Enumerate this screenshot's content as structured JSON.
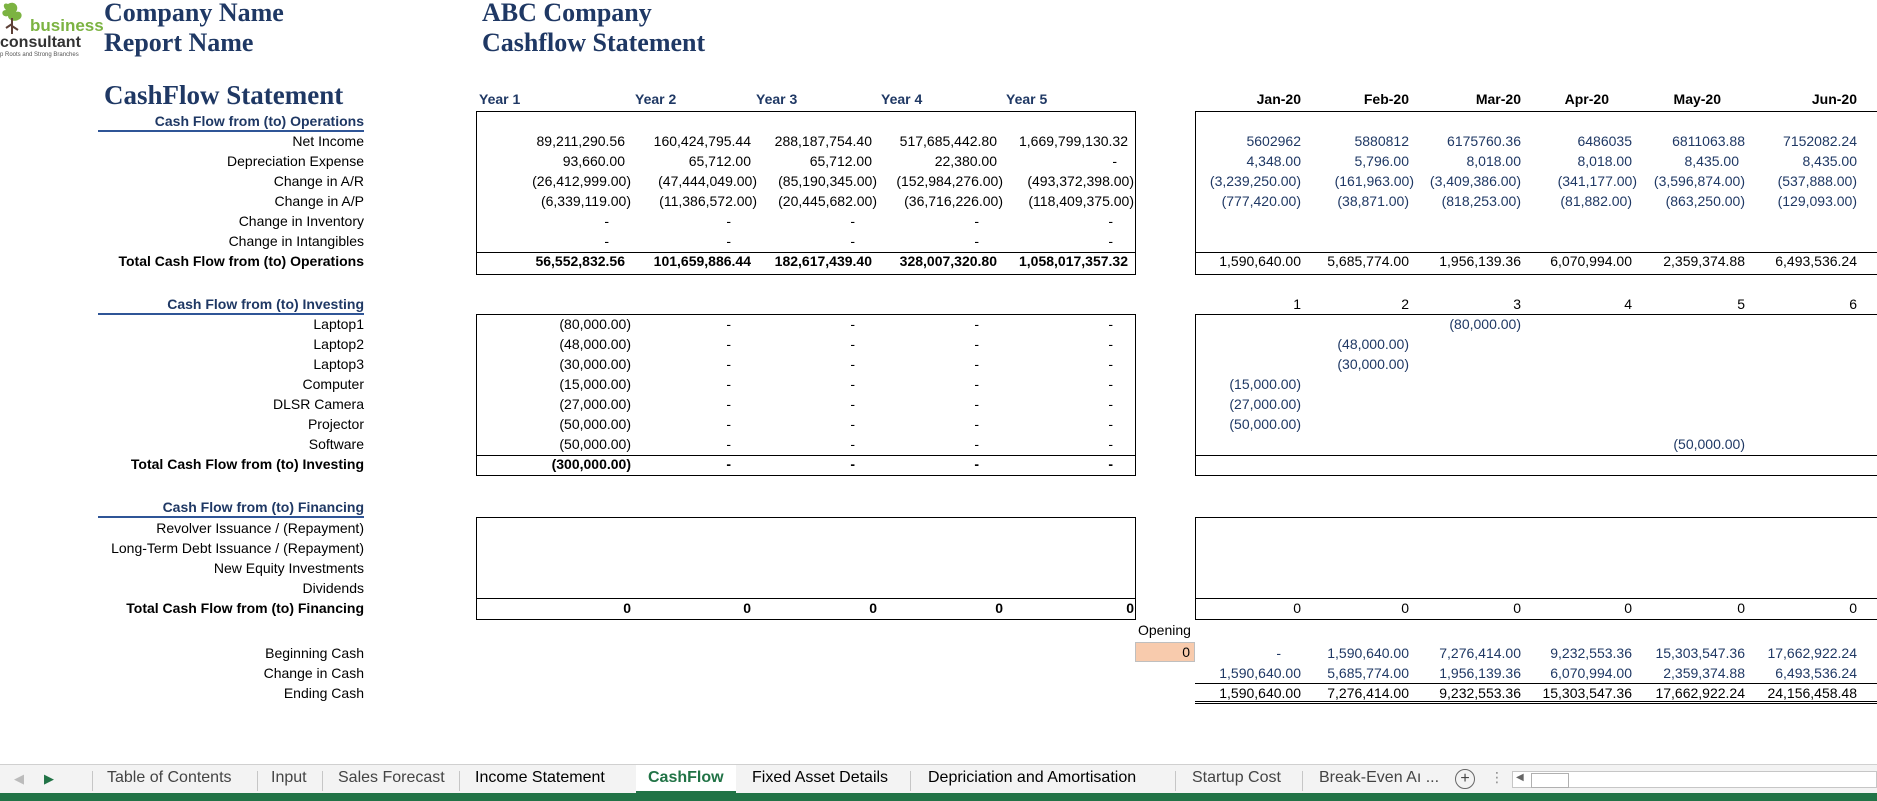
{
  "header": {
    "company_label": "Company Name",
    "report_label": "Report Name",
    "company_value": "ABC Company",
    "report_value": "Cashflow Statement",
    "title": "CashFlow Statement"
  },
  "logo": {
    "word1": "business",
    "word2": "consultant",
    "tagline": "p Roots and Strong Branches",
    "icon": "tree-logo-icon"
  },
  "years": [
    "Year 1",
    "Year 2",
    "Year 3",
    "Year 4",
    "Year 5"
  ],
  "months": [
    "Jan-20",
    "Feb-20",
    "Mar-20",
    "Apr-20",
    "May-20",
    "Jun-20"
  ],
  "month_numbers": [
    "1",
    "2",
    "3",
    "4",
    "5",
    "6"
  ],
  "operations": {
    "title": "Cash Flow from (to) Operations",
    "rows": [
      {
        "label": "Net Income",
        "years": [
          "89,211,290.56",
          "160,424,795.44",
          "288,187,754.40",
          "517,685,442.80",
          "1,669,799,130.32"
        ],
        "months": [
          "5602962",
          "5880812",
          "6175760.36",
          "6486035",
          "6811063.88",
          "7152082.24"
        ]
      },
      {
        "label": "Depreciation Expense",
        "years": [
          "93,660.00",
          "65,712.00",
          "65,712.00",
          "22,380.00",
          "-"
        ],
        "months": [
          "4,348.00",
          "5,796.00",
          "8,018.00",
          "8,018.00",
          "8,435.00",
          "8,435.00"
        ]
      },
      {
        "label": "Change in A/R",
        "years": [
          "(26,412,999.00)",
          "(47,444,049.00)",
          "(85,190,345.00)",
          "(152,984,276.00)",
          "(493,372,398.00)"
        ],
        "months": [
          "(3,239,250.00)",
          "(161,963.00)",
          "(3,409,386.00)",
          "(341,177.00)",
          "(3,596,874.00)",
          "(537,888.00)"
        ]
      },
      {
        "label": "Change in A/P",
        "years": [
          "(6,339,119.00)",
          "(11,386,572.00)",
          "(20,445,682.00)",
          "(36,716,226.00)",
          "(118,409,375.00)"
        ],
        "months": [
          "(777,420.00)",
          "(38,871.00)",
          "(818,253.00)",
          "(81,882.00)",
          "(863,250.00)",
          "(129,093.00)"
        ]
      },
      {
        "label": "Change in Inventory",
        "years": [
          "-",
          "-",
          "-",
          "-",
          "-"
        ],
        "months": [
          "",
          "",
          "",
          "",
          "",
          ""
        ]
      },
      {
        "label": "Change in Intangibles",
        "years": [
          "-",
          "-",
          "-",
          "-",
          "-"
        ],
        "months": [
          "",
          "",
          "",
          "",
          "",
          ""
        ]
      }
    ],
    "total_label": "Total Cash Flow from (to) Operations",
    "total_years": [
      "56,552,832.56",
      "101,659,886.44",
      "182,617,439.40",
      "328,007,320.80",
      "1,058,017,357.32"
    ],
    "total_months": [
      "1,590,640.00",
      "5,685,774.00",
      "1,956,139.36",
      "6,070,994.00",
      "2,359,374.88",
      "6,493,536.24"
    ]
  },
  "investing": {
    "title": "Cash Flow from (to) Investing",
    "rows": [
      {
        "label": "Laptop1",
        "years": [
          "(80,000.00)",
          "-",
          "-",
          "-",
          "-"
        ],
        "months": [
          "",
          "",
          "(80,000.00)",
          "",
          "",
          ""
        ]
      },
      {
        "label": "Laptop2",
        "years": [
          "(48,000.00)",
          "-",
          "-",
          "-",
          "-"
        ],
        "months": [
          "",
          "(48,000.00)",
          "",
          "",
          "",
          ""
        ]
      },
      {
        "label": "Laptop3",
        "years": [
          "(30,000.00)",
          "-",
          "-",
          "-",
          "-"
        ],
        "months": [
          "",
          "(30,000.00)",
          "",
          "",
          "",
          ""
        ]
      },
      {
        "label": "Computer",
        "years": [
          "(15,000.00)",
          "-",
          "-",
          "-",
          "-"
        ],
        "months": [
          "(15,000.00)",
          "",
          "",
          "",
          "",
          ""
        ]
      },
      {
        "label": "DLSR Camera",
        "years": [
          "(27,000.00)",
          "-",
          "-",
          "-",
          "-"
        ],
        "months": [
          "(27,000.00)",
          "",
          "",
          "",
          "",
          ""
        ]
      },
      {
        "label": "Projector",
        "years": [
          "(50,000.00)",
          "-",
          "-",
          "-",
          "-"
        ],
        "months": [
          "(50,000.00)",
          "",
          "",
          "",
          "",
          ""
        ]
      },
      {
        "label": "Software",
        "years": [
          "(50,000.00)",
          "-",
          "-",
          "-",
          "-"
        ],
        "months": [
          "",
          "",
          "",
          "",
          "(50,000.00)",
          ""
        ]
      }
    ],
    "total_label": "Total Cash Flow from (to) Investing",
    "total_years": [
      "(300,000.00)",
      "-",
      "-",
      "-",
      "-"
    ]
  },
  "financing": {
    "title": "Cash Flow from (to) Financing",
    "rows": [
      {
        "label": "Revolver Issuance / (Repayment)"
      },
      {
        "label": "Long-Term Debt Issuance / (Repayment)"
      },
      {
        "label": "New Equity Investments"
      },
      {
        "label": "Dividends"
      }
    ],
    "total_label": "Total Cash Flow from (to) Financing",
    "total_years": [
      "0",
      "0",
      "0",
      "0",
      "0"
    ],
    "total_months": [
      "0",
      "0",
      "0",
      "0",
      "0",
      "0"
    ]
  },
  "cash": {
    "opening_label": "Opening",
    "opening_value": "0",
    "rows": [
      {
        "label": "Beginning Cash",
        "months": [
          "-",
          "1,590,640.00",
          "7,276,414.00",
          "9,232,553.36",
          "15,303,547.36",
          "17,662,922.24"
        ]
      },
      {
        "label": "Change in Cash",
        "months": [
          "1,590,640.00",
          "5,685,774.00",
          "1,956,139.36",
          "6,070,994.00",
          "2,359,374.88",
          "6,493,536.24"
        ]
      },
      {
        "label": "Ending Cash",
        "months": [
          "1,590,640.00",
          "7,276,414.00",
          "9,232,553.36",
          "15,303,547.36",
          "17,662,922.24",
          "24,156,458.48"
        ]
      }
    ]
  },
  "tabs": [
    "Table of Contents",
    "Input",
    "Sales Forecast",
    "Income Statement",
    "CashFlow",
    "Fixed Asset Details",
    "Depriciation and Amortisation",
    "Startup Cost",
    "Break-Even Aı ..."
  ],
  "active_tab": "CashFlow",
  "colors": {
    "accent": "#1f3864",
    "excel_green": "#217346",
    "opening_fill": "#f8cbad"
  }
}
